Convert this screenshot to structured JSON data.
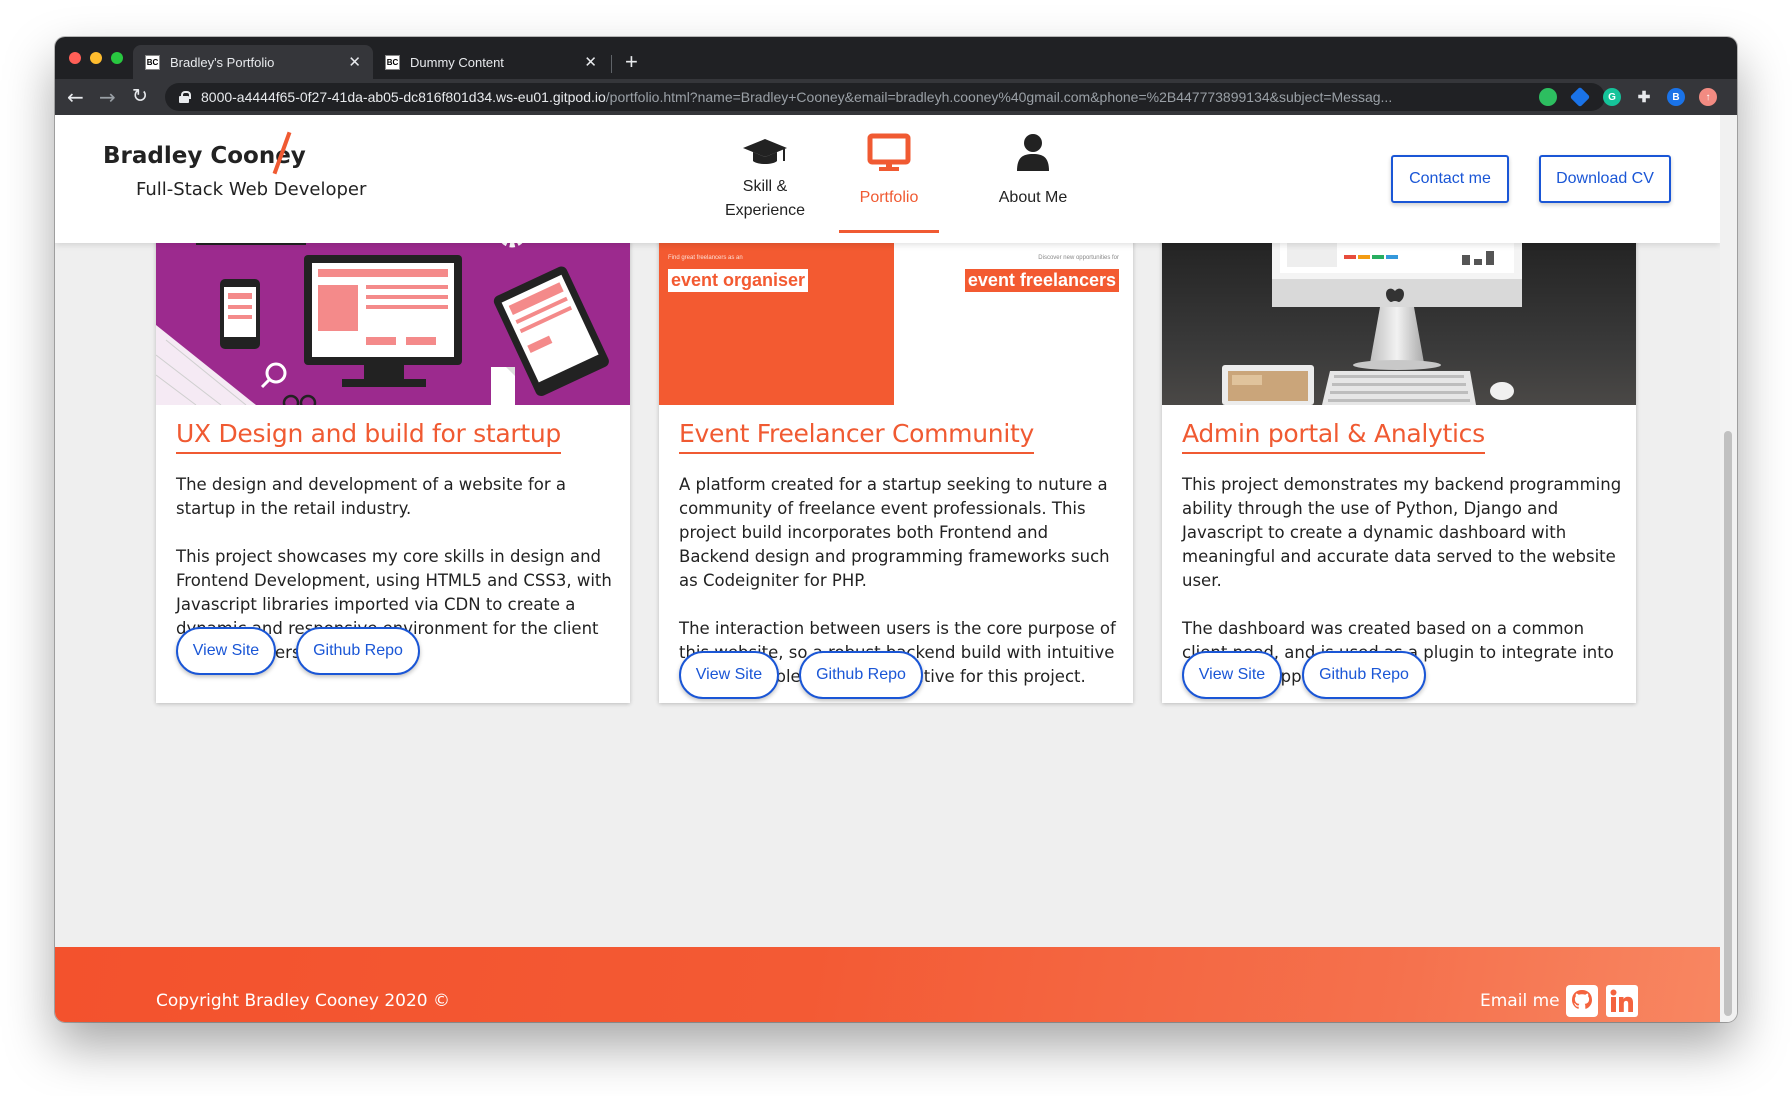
{
  "browser": {
    "tabs": [
      {
        "title": "Bradley's Portfolio",
        "active": true
      },
      {
        "title": "Dummy Content",
        "active": false
      }
    ],
    "new_tab": "+",
    "url_host": "8000-a4444f65-0f27-41da-ab05-dc816f801d34.ws-eu01.gitpod.io",
    "url_path": "/portfolio.html?name=Bradley+Cooney&email=bradleyh.cooney%40gmail.com&phone=%2B447773899134&subject=Messag...",
    "extensions": [
      {
        "name": "evernote-icon",
        "color": "#2dbe60"
      },
      {
        "name": "shield-extension-icon",
        "color": "#1a73e8"
      },
      {
        "name": "grammarly-icon",
        "color": "#15c39a",
        "text": "G"
      },
      {
        "name": "puzzle-icon",
        "color": "#e8eaed"
      },
      {
        "name": "profile-avatar",
        "color": "#1a73e8",
        "text": "B"
      },
      {
        "name": "update-icon",
        "color": "#f28b82"
      }
    ]
  },
  "header": {
    "brand_name": "Bradley Cooney",
    "brand_tagline": "Full-Stack Web Developer",
    "nav": [
      {
        "label": "Skill &\nExperience",
        "icon": "graduation-cap-icon",
        "active": false
      },
      {
        "label": "Portfolio",
        "icon": "monitor-icon",
        "active": true
      },
      {
        "label": "About Me",
        "icon": "user-icon",
        "active": false
      }
    ],
    "contact_label": "Contact me",
    "cv_label": "Download CV"
  },
  "projects": [
    {
      "title": "UX Design and build for startup",
      "paragraphs": [
        "The design and development of a website for a startup in the retail industry.",
        "This project showcases my core skills in design and Frontend Development, using HTML5 and CSS3, with Javascript libraries imported via CDN to create a dynamic and responsive environment for the client and their users."
      ],
      "view_label": "View Site",
      "repo_label": "Github Repo"
    },
    {
      "title": "Event Freelancer Community",
      "paragraphs": [
        "A platform created for a startup seeking to nuture a community of freelance event professionals. This project build incorporates both Frontend and Backend design and programming frameworks such as Codeigniter for PHP.",
        "The interaction between users is the core purpose of this website, so a robust backend build with intuitive and accessible UI was imperative for this project."
      ],
      "image_text": {
        "small_left": "Find great freelancers as an",
        "big_left": "event organiser",
        "small_right": "Discover new opportunities for",
        "big_right": "event freelancers"
      },
      "view_label": "View Site",
      "repo_label": "Github Repo"
    },
    {
      "title": "Admin portal & Analytics",
      "paragraphs": [
        "This project demonstrates my backend programming ability through the use of Python, Django and Javascript to create a dynamic dashboard with meaningful and accurate data served to the website user.",
        "The dashboard was created based on a common client need, and is used as a plugin to integrate into other web applications."
      ],
      "view_label": "View Site",
      "repo_label": "Github Repo"
    }
  ],
  "footer": {
    "copyright": "Copyright Bradley Cooney 2020 ©",
    "email_label": "Email me"
  },
  "colors": {
    "accent": "#f05a32",
    "link_blue": "#1a56d6",
    "card_purple": "#9c2a8e"
  }
}
